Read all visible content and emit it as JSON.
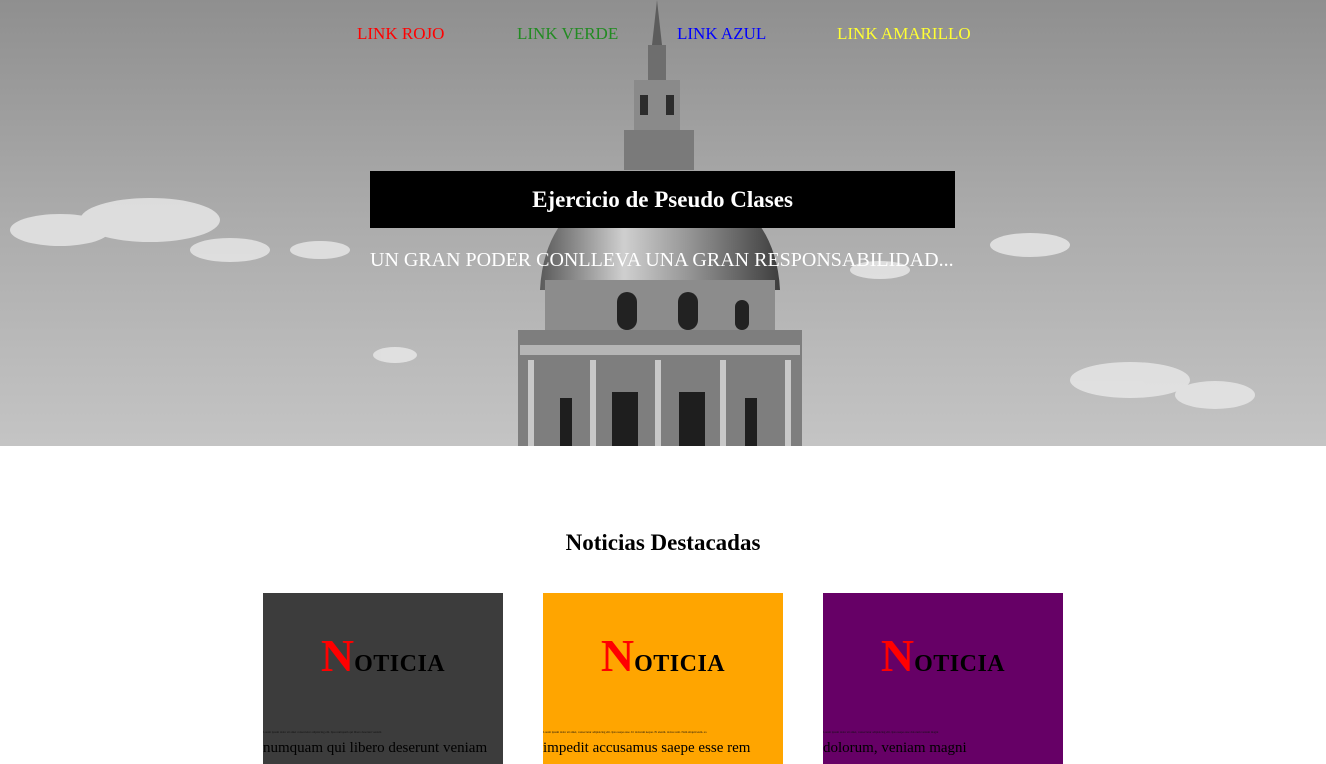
{
  "nav": {
    "links": [
      {
        "label": "LINK ROJO",
        "color": "#ff0000"
      },
      {
        "label": "LINK VERDE",
        "color": "#228b22"
      },
      {
        "label": "LINK AZUL",
        "color": "#0000ff"
      },
      {
        "label": "LINK AMARILLO",
        "color": "#ffff33"
      }
    ]
  },
  "hero": {
    "title": "Ejercicio de Pseudo Clases",
    "subtitle": "UN GRAN PODER CONLLEVA UNA GRAN RESPONSABILIDAD..."
  },
  "news": {
    "section_title": "Noticias Destacadas",
    "cards": [
      {
        "heading_first": "N",
        "heading_rest": "OTICIA",
        "background": "#3c3c3c",
        "tiny_text": "Lorem ipsum dolor sit amet consectetur adipisicing elit. Ipsa numquam qui libero deserunt veniam",
        "body_text": "numquam qui libero deserunt veniam"
      },
      {
        "heading_first": "N",
        "heading_rest": "OTICIA",
        "background": "#ffa500",
        "tiny_text": "Lorem ipsum dolor sit amet, consectetur adipisicing elit. Ipsa saepe esse. Ut dolorum neque. Et eleniti. dolore rem. Nam aliquid eum. ea",
        "body_text": "impedit accusamus saepe esse rem"
      },
      {
        "heading_first": "N",
        "heading_rest": "OTICIA",
        "background": "#660066",
        "tiny_text": "Lorem ipsum dolor sit amet, consectetur adipisicing elit. Ipsa saepe esse dolorum veniam magni",
        "body_text": "dolorum, veniam magni"
      }
    ]
  }
}
